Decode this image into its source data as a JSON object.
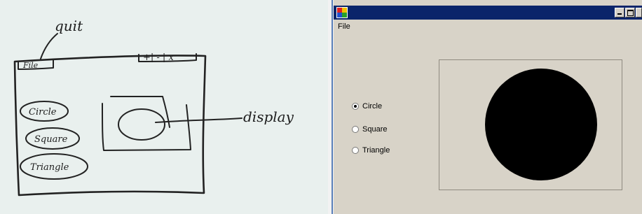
{
  "sketch": {
    "annotation_quit": "quit",
    "menu_file": "File",
    "window_controls": "+| - | x",
    "buttons": [
      "Circle",
      "Square",
      "Triangle"
    ],
    "annotation_display": "display"
  },
  "app": {
    "icon": "app-icon",
    "title": "",
    "caption_buttons": [
      "minimize",
      "maximize",
      "close"
    ],
    "menu": [
      {
        "label": "File"
      }
    ],
    "shape_options": [
      {
        "label": "Circle",
        "checked": true
      },
      {
        "label": "Square",
        "checked": false
      },
      {
        "label": "Triangle",
        "checked": false
      }
    ],
    "display_shape": "circle",
    "colors": {
      "titlebar": "#0a246a",
      "form_background": "#d8d3c8",
      "shape_fill": "#000000"
    }
  }
}
